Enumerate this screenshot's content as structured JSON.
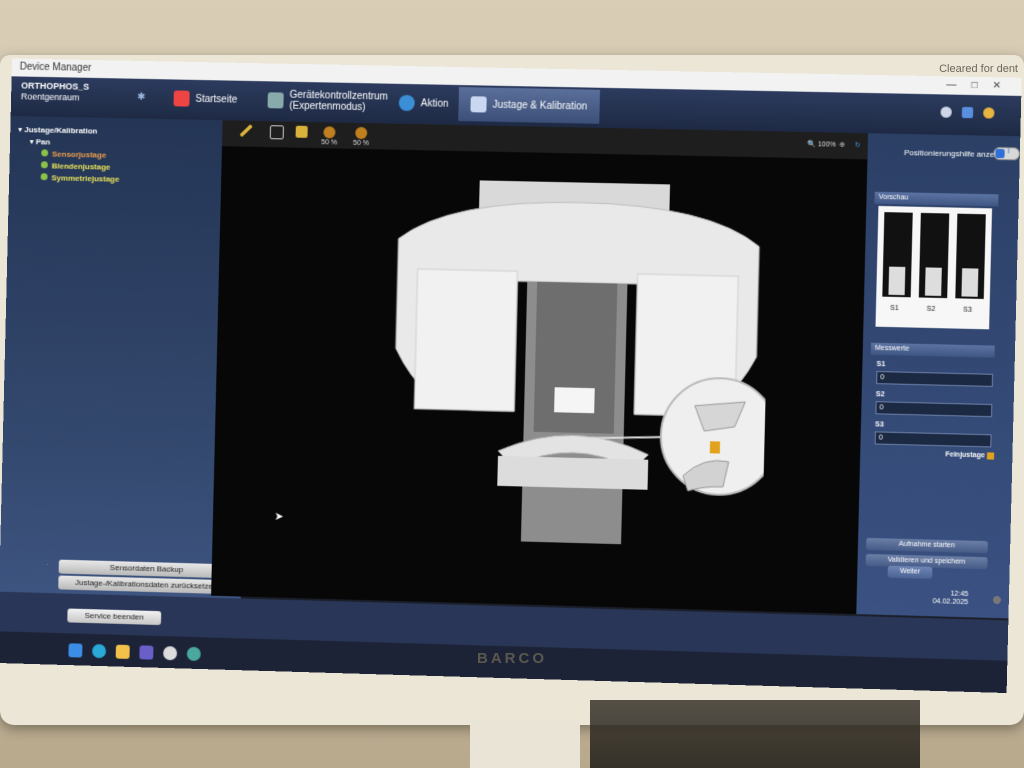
{
  "window": {
    "title": "Device Manager",
    "controls": [
      "—",
      "□",
      "✕"
    ]
  },
  "device": {
    "name": "ORTHOPHOS_S",
    "room": "Roentgenraum"
  },
  "nav": {
    "crumbs": [
      "Startseite",
      "Gerätekontrollzentrum\n(Expertenmodus)",
      "Aktion",
      "Justage & Kalibration"
    ]
  },
  "tree": {
    "root": "Justage/Kalibration",
    "group": "Pan",
    "items": [
      "Sensorjustage",
      "Blendenjustage",
      "Symmetriejustage"
    ]
  },
  "left_buttons": {
    "backup": "Sensordaten Backup",
    "reset": "Justage-/Kalibrationsdaten zurücksetzen"
  },
  "toolbar": {
    "zoom_a": "50 %",
    "zoom_b": "50 %",
    "zoom_right": "100%"
  },
  "right": {
    "pos_label": "Positionierungshilfe anzeigen",
    "toggle_value": "I",
    "preview_head": "Vorschau",
    "preview_labels": [
      "S1",
      "S2",
      "S3"
    ],
    "mess_head": "Messwerte",
    "s1_label": "S1",
    "s1_value": "0",
    "s2_label": "S2",
    "s2_value": "0",
    "s3_label": "S3",
    "s3_value": "0",
    "fein_label": "Feinjustage",
    "btn_start": "Aufnahme starten",
    "btn_valid": "Validieren und speichern",
    "btn_next": "Weiter"
  },
  "service": {
    "label": "Service beenden"
  },
  "clock": {
    "time": "12:45",
    "date": "04.02.2025"
  },
  "bezel": {
    "brand": "BARCO",
    "sticker": "Cleared for dent"
  },
  "colors": {
    "nav": "#25324f",
    "accent": "#f0a04a",
    "ok": "#8bc24a"
  }
}
